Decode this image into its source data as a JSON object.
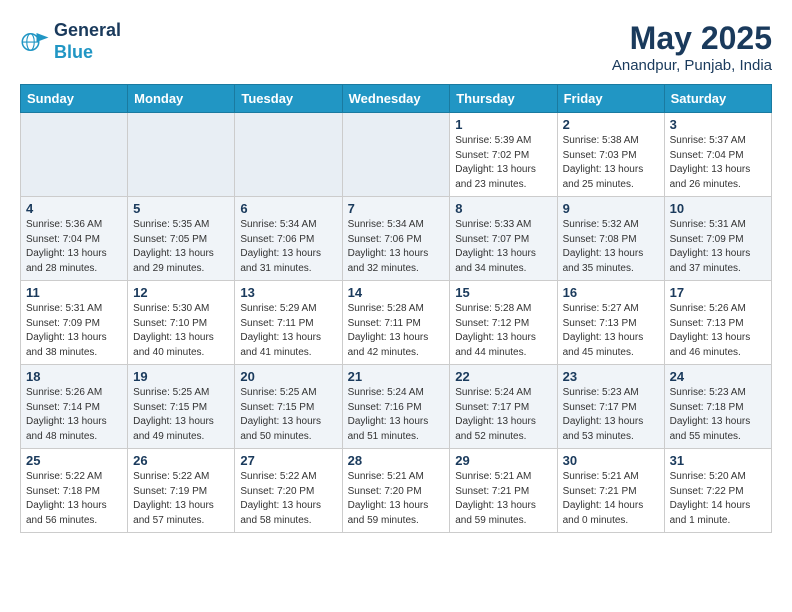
{
  "header": {
    "logo_line1": "General",
    "logo_line2": "Blue",
    "month": "May 2025",
    "location": "Anandpur, Punjab, India"
  },
  "days_of_week": [
    "Sunday",
    "Monday",
    "Tuesday",
    "Wednesday",
    "Thursday",
    "Friday",
    "Saturday"
  ],
  "weeks": [
    [
      {
        "day": "",
        "info": ""
      },
      {
        "day": "",
        "info": ""
      },
      {
        "day": "",
        "info": ""
      },
      {
        "day": "",
        "info": ""
      },
      {
        "day": "1",
        "info": "Sunrise: 5:39 AM\nSunset: 7:02 PM\nDaylight: 13 hours\nand 23 minutes."
      },
      {
        "day": "2",
        "info": "Sunrise: 5:38 AM\nSunset: 7:03 PM\nDaylight: 13 hours\nand 25 minutes."
      },
      {
        "day": "3",
        "info": "Sunrise: 5:37 AM\nSunset: 7:04 PM\nDaylight: 13 hours\nand 26 minutes."
      }
    ],
    [
      {
        "day": "4",
        "info": "Sunrise: 5:36 AM\nSunset: 7:04 PM\nDaylight: 13 hours\nand 28 minutes."
      },
      {
        "day": "5",
        "info": "Sunrise: 5:35 AM\nSunset: 7:05 PM\nDaylight: 13 hours\nand 29 minutes."
      },
      {
        "day": "6",
        "info": "Sunrise: 5:34 AM\nSunset: 7:06 PM\nDaylight: 13 hours\nand 31 minutes."
      },
      {
        "day": "7",
        "info": "Sunrise: 5:34 AM\nSunset: 7:06 PM\nDaylight: 13 hours\nand 32 minutes."
      },
      {
        "day": "8",
        "info": "Sunrise: 5:33 AM\nSunset: 7:07 PM\nDaylight: 13 hours\nand 34 minutes."
      },
      {
        "day": "9",
        "info": "Sunrise: 5:32 AM\nSunset: 7:08 PM\nDaylight: 13 hours\nand 35 minutes."
      },
      {
        "day": "10",
        "info": "Sunrise: 5:31 AM\nSunset: 7:09 PM\nDaylight: 13 hours\nand 37 minutes."
      }
    ],
    [
      {
        "day": "11",
        "info": "Sunrise: 5:31 AM\nSunset: 7:09 PM\nDaylight: 13 hours\nand 38 minutes."
      },
      {
        "day": "12",
        "info": "Sunrise: 5:30 AM\nSunset: 7:10 PM\nDaylight: 13 hours\nand 40 minutes."
      },
      {
        "day": "13",
        "info": "Sunrise: 5:29 AM\nSunset: 7:11 PM\nDaylight: 13 hours\nand 41 minutes."
      },
      {
        "day": "14",
        "info": "Sunrise: 5:28 AM\nSunset: 7:11 PM\nDaylight: 13 hours\nand 42 minutes."
      },
      {
        "day": "15",
        "info": "Sunrise: 5:28 AM\nSunset: 7:12 PM\nDaylight: 13 hours\nand 44 minutes."
      },
      {
        "day": "16",
        "info": "Sunrise: 5:27 AM\nSunset: 7:13 PM\nDaylight: 13 hours\nand 45 minutes."
      },
      {
        "day": "17",
        "info": "Sunrise: 5:26 AM\nSunset: 7:13 PM\nDaylight: 13 hours\nand 46 minutes."
      }
    ],
    [
      {
        "day": "18",
        "info": "Sunrise: 5:26 AM\nSunset: 7:14 PM\nDaylight: 13 hours\nand 48 minutes."
      },
      {
        "day": "19",
        "info": "Sunrise: 5:25 AM\nSunset: 7:15 PM\nDaylight: 13 hours\nand 49 minutes."
      },
      {
        "day": "20",
        "info": "Sunrise: 5:25 AM\nSunset: 7:15 PM\nDaylight: 13 hours\nand 50 minutes."
      },
      {
        "day": "21",
        "info": "Sunrise: 5:24 AM\nSunset: 7:16 PM\nDaylight: 13 hours\nand 51 minutes."
      },
      {
        "day": "22",
        "info": "Sunrise: 5:24 AM\nSunset: 7:17 PM\nDaylight: 13 hours\nand 52 minutes."
      },
      {
        "day": "23",
        "info": "Sunrise: 5:23 AM\nSunset: 7:17 PM\nDaylight: 13 hours\nand 53 minutes."
      },
      {
        "day": "24",
        "info": "Sunrise: 5:23 AM\nSunset: 7:18 PM\nDaylight: 13 hours\nand 55 minutes."
      }
    ],
    [
      {
        "day": "25",
        "info": "Sunrise: 5:22 AM\nSunset: 7:18 PM\nDaylight: 13 hours\nand 56 minutes."
      },
      {
        "day": "26",
        "info": "Sunrise: 5:22 AM\nSunset: 7:19 PM\nDaylight: 13 hours\nand 57 minutes."
      },
      {
        "day": "27",
        "info": "Sunrise: 5:22 AM\nSunset: 7:20 PM\nDaylight: 13 hours\nand 58 minutes."
      },
      {
        "day": "28",
        "info": "Sunrise: 5:21 AM\nSunset: 7:20 PM\nDaylight: 13 hours\nand 59 minutes."
      },
      {
        "day": "29",
        "info": "Sunrise: 5:21 AM\nSunset: 7:21 PM\nDaylight: 13 hours\nand 59 minutes."
      },
      {
        "day": "30",
        "info": "Sunrise: 5:21 AM\nSunset: 7:21 PM\nDaylight: 14 hours\nand 0 minutes."
      },
      {
        "day": "31",
        "info": "Sunrise: 5:20 AM\nSunset: 7:22 PM\nDaylight: 14 hours\nand 1 minute."
      }
    ]
  ]
}
